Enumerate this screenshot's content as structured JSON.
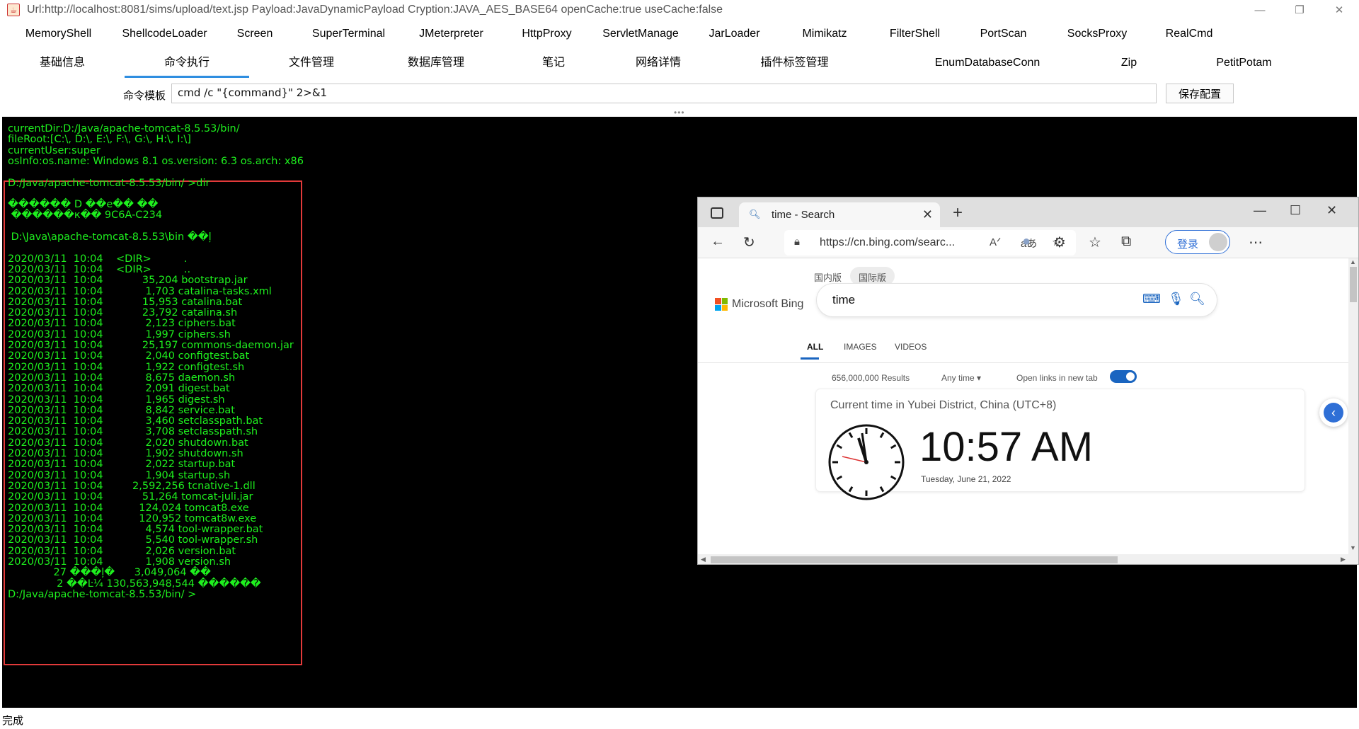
{
  "window": {
    "title": "Url:http://localhost:8081/sims/upload/text.jsp Payload:JavaDynamicPayload Cryption:JAVA_AES_BASE64 openCache:true useCache:false"
  },
  "plugins": [
    "MemoryShell",
    "ShellcodeLoader",
    "Screen",
    "SuperTerminal",
    "JMeterpreter",
    "HttpProxy",
    "ServletManage",
    "JarLoader",
    "Mimikatz",
    "FilterShell",
    "PortScan",
    "SocksProxy",
    "RealCmd"
  ],
  "tabs": [
    "基础信息",
    "命令执行",
    "文件管理",
    "数据库管理",
    "笔记",
    "网络详情",
    "插件标签管理",
    "EnumDatabaseConn",
    "Zip",
    "PetitPotam"
  ],
  "command": {
    "template_label": "命令模板",
    "template_value": "cmd /c \"{command}\" 2>&1",
    "save_label": "保存配置"
  },
  "terminal": {
    "lines": [
      "currentDir:D:/Java/apache-tomcat-8.5.53/bin/",
      "fileRoot:[C:\\, D:\\, E:\\, F:\\, G:\\, H:\\, I:\\]",
      "currentUser:super",
      "osInfo:os.name: Windows 8.1 os.version: 6.3 os.arch: x86",
      "",
      "D:/Java/apache-tomcat-8.5.53/bin/ >dir",
      "",
      "������ D ��е�� ��",
      " ������к�� 9C6A-C234",
      "",
      " D:\\Java\\apache-tomcat-8.5.53\\bin ��ļ",
      "",
      "2020/03/11  10:04    <DIR>          .",
      "2020/03/11  10:04    <DIR>          ..",
      "2020/03/11  10:04            35,204 bootstrap.jar",
      "2020/03/11  10:04             1,703 catalina-tasks.xml",
      "2020/03/11  10:04            15,953 catalina.bat",
      "2020/03/11  10:04            23,792 catalina.sh",
      "2020/03/11  10:04             2,123 ciphers.bat",
      "2020/03/11  10:04             1,997 ciphers.sh",
      "2020/03/11  10:04            25,197 commons-daemon.jar",
      "2020/03/11  10:04             2,040 configtest.bat",
      "2020/03/11  10:04             1,922 configtest.sh",
      "2020/03/11  10:04             8,675 daemon.sh",
      "2020/03/11  10:04             2,091 digest.bat",
      "2020/03/11  10:04             1,965 digest.sh",
      "2020/03/11  10:04             8,842 service.bat",
      "2020/03/11  10:04             3,460 setclasspath.bat",
      "2020/03/11  10:04             3,708 setclasspath.sh",
      "2020/03/11  10:04             2,020 shutdown.bat",
      "2020/03/11  10:04             1,902 shutdown.sh",
      "2020/03/11  10:04             2,022 startup.bat",
      "2020/03/11  10:04             1,904 startup.sh",
      "2020/03/11  10:04         2,592,256 tcnative-1.dll",
      "2020/03/11  10:04            51,264 tomcat-juli.jar",
      "2020/03/11  10:04           124,024 tomcat8.exe",
      "2020/03/11  10:04           120,952 tomcat8w.exe",
      "2020/03/11  10:04             4,574 tool-wrapper.bat",
      "2020/03/11  10:04             5,540 tool-wrapper.sh",
      "2020/03/11  10:04             2,026 version.bat",
      "2020/03/11  10:04             1,908 version.sh",
      "              27 ���ļ�      3,049,064 ��",
      "               2 ��Ŀ¼ 130,563,948,544 ������",
      "D:/Java/apache-tomcat-8.5.53/bin/ >"
    ]
  },
  "status": "完成",
  "browser": {
    "tab_title": "time - Search",
    "url": "https://cn.bing.com/searc...",
    "signin": "登录",
    "region_cn": "国内版",
    "region_intl": "国际版",
    "logo_text": "Microsoft Bing",
    "query": "time",
    "vertical_tabs": [
      "ALL",
      "IMAGES",
      "VIDEOS"
    ],
    "results_count": "656,000,000 Results",
    "any_time": "Any time",
    "open_links": "Open links in new tab",
    "card_location": "Current time in Yubei District, China (UTC+8)",
    "card_time": "10:57 AM",
    "card_date": "Tuesday, June 21, 2022",
    "accent_color": "#1a65c0"
  },
  "colors": {
    "terminal_bg": "#000000",
    "terminal_text": "#1ef01e",
    "highlight_box": "#e23a3a",
    "active_tab_underline": "#2f8ee0"
  }
}
